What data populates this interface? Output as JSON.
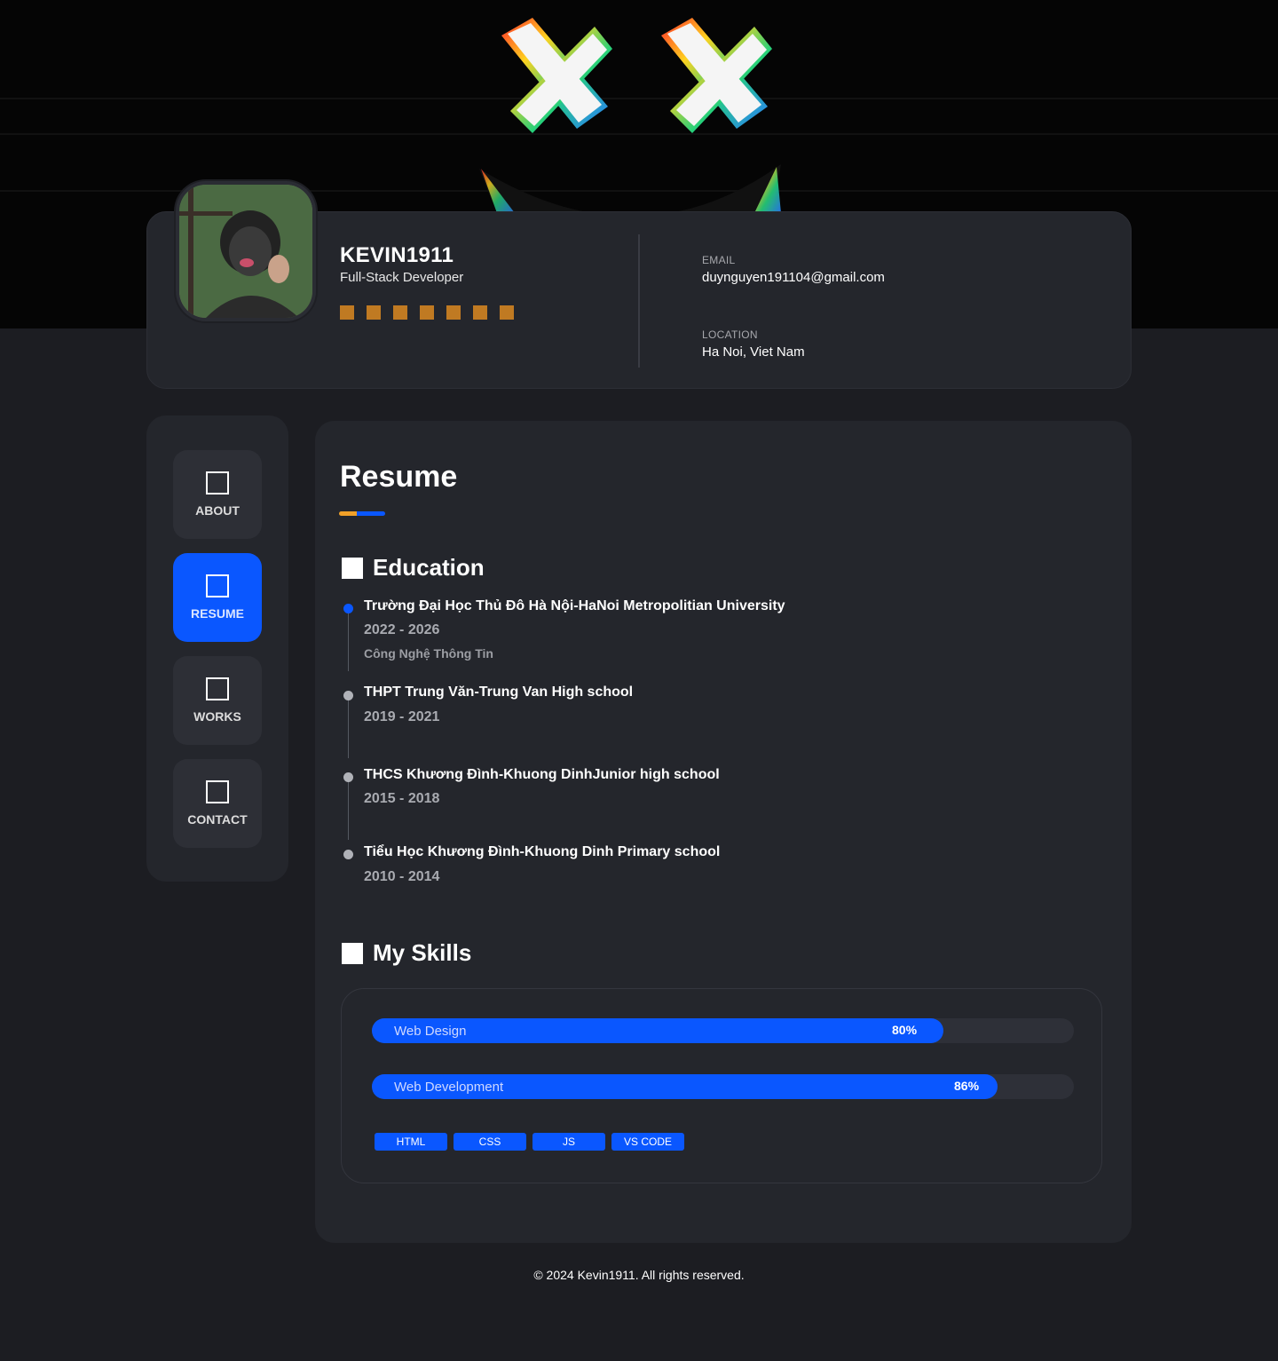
{
  "profile": {
    "name": "KEVIN1911",
    "role": "Full-Stack Developer",
    "email_label": "EMAIL",
    "email": "duynguyen191104@gmail.com",
    "location_label": "LOCATION",
    "location": "Ha Noi, Viet Nam",
    "accent_dots": 7
  },
  "nav": {
    "items": [
      {
        "label": "ABOUT",
        "icon": "square-icon",
        "active": false
      },
      {
        "label": "RESUME",
        "icon": "square-icon",
        "active": true
      },
      {
        "label": "WORKS",
        "icon": "square-icon",
        "active": false
      },
      {
        "label": "CONTACT",
        "icon": "square-icon",
        "active": false
      }
    ]
  },
  "resume": {
    "title": "Resume",
    "education_title": "Education",
    "education": [
      {
        "school": "Trường Đại Học Thủ Đô Hà Nội-HaNoi Metropolitian University",
        "years": "2022 - 2026",
        "major": "Công Nghệ Thông Tin",
        "active": true
      },
      {
        "school": "THPT Trung Văn-Trung Van High school",
        "years": "2019 - 2021",
        "active": false
      },
      {
        "school": "THCS Khương Đình-Khuong DinhJunior high school",
        "years": "2015 - 2018",
        "active": false
      },
      {
        "school": "Tiểu Học Khương Đình-Khuong Dinh Primary school",
        "years": "2010 - 2014",
        "active": false
      }
    ],
    "skills_title": "My Skills",
    "skills": [
      {
        "name": "Web Design",
        "percent_label": "80%",
        "value": 0.8
      },
      {
        "name": "Web Development",
        "percent_label": "86%",
        "value": 0.86
      }
    ],
    "tags": [
      "HTML",
      "CSS",
      "JS",
      "VS CODE"
    ]
  },
  "footer": "© 2024 Kevin1911. All rights reserved.",
  "colors": {
    "accent": "#0a57ff",
    "orange": "#c07a22",
    "card": "#24262c"
  }
}
